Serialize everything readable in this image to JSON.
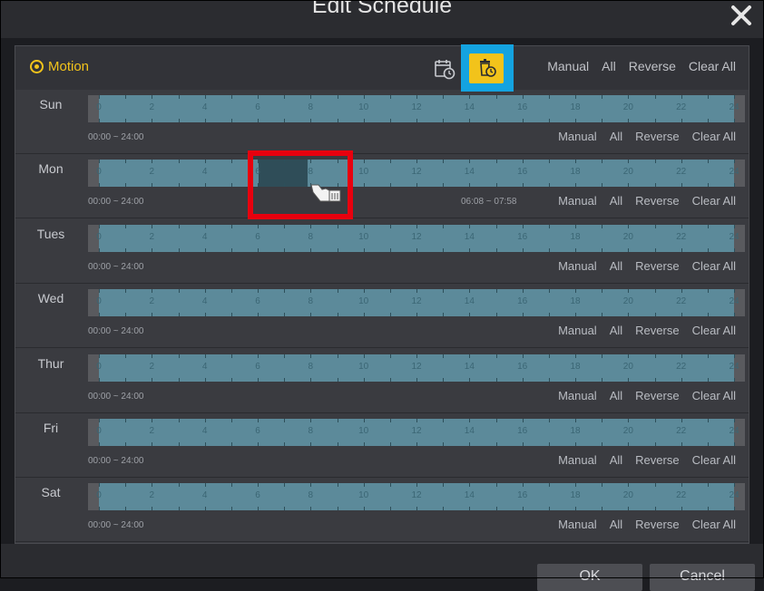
{
  "window": {
    "title": "Edit Schedule"
  },
  "header": {
    "mode_label": "Motion",
    "actions": [
      "Manual",
      "All",
      "Reverse",
      "Clear All"
    ]
  },
  "timeline_ticks": [
    "0",
    "2",
    "4",
    "6",
    "8",
    "10",
    "12",
    "14",
    "16",
    "18",
    "20",
    "22",
    "24"
  ],
  "days": [
    {
      "label": "Sun",
      "range": "00:00 ~ 24:00",
      "selection_range": ""
    },
    {
      "label": "Mon",
      "range": "00:00 ~ 24:00",
      "selection_range": "06:08 ~ 07:58"
    },
    {
      "label": "Tues",
      "range": "00:00 ~ 24:00",
      "selection_range": ""
    },
    {
      "label": "Wed",
      "range": "00:00 ~ 24:00",
      "selection_range": ""
    },
    {
      "label": "Thur",
      "range": "00:00 ~ 24:00",
      "selection_range": ""
    },
    {
      "label": "Fri",
      "range": "00:00 ~ 24:00",
      "selection_range": ""
    },
    {
      "label": "Sat",
      "range": "00:00 ~ 24:00",
      "selection_range": ""
    }
  ],
  "row_actions": [
    "Manual",
    "All",
    "Reverse",
    "Clear All"
  ],
  "footer": {
    "ok_label": "OK",
    "cancel_label": "Cancel"
  },
  "colors": {
    "accent": "#f2c31b",
    "highlight": "#14a3e0",
    "annotation": "#e8000e",
    "timeline": "#5c8a9a",
    "selection": "#2f4d58"
  },
  "icons": [
    "close-icon",
    "schedule-add-icon",
    "schedule-delete-icon",
    "hand-delete-cursor-icon"
  ]
}
